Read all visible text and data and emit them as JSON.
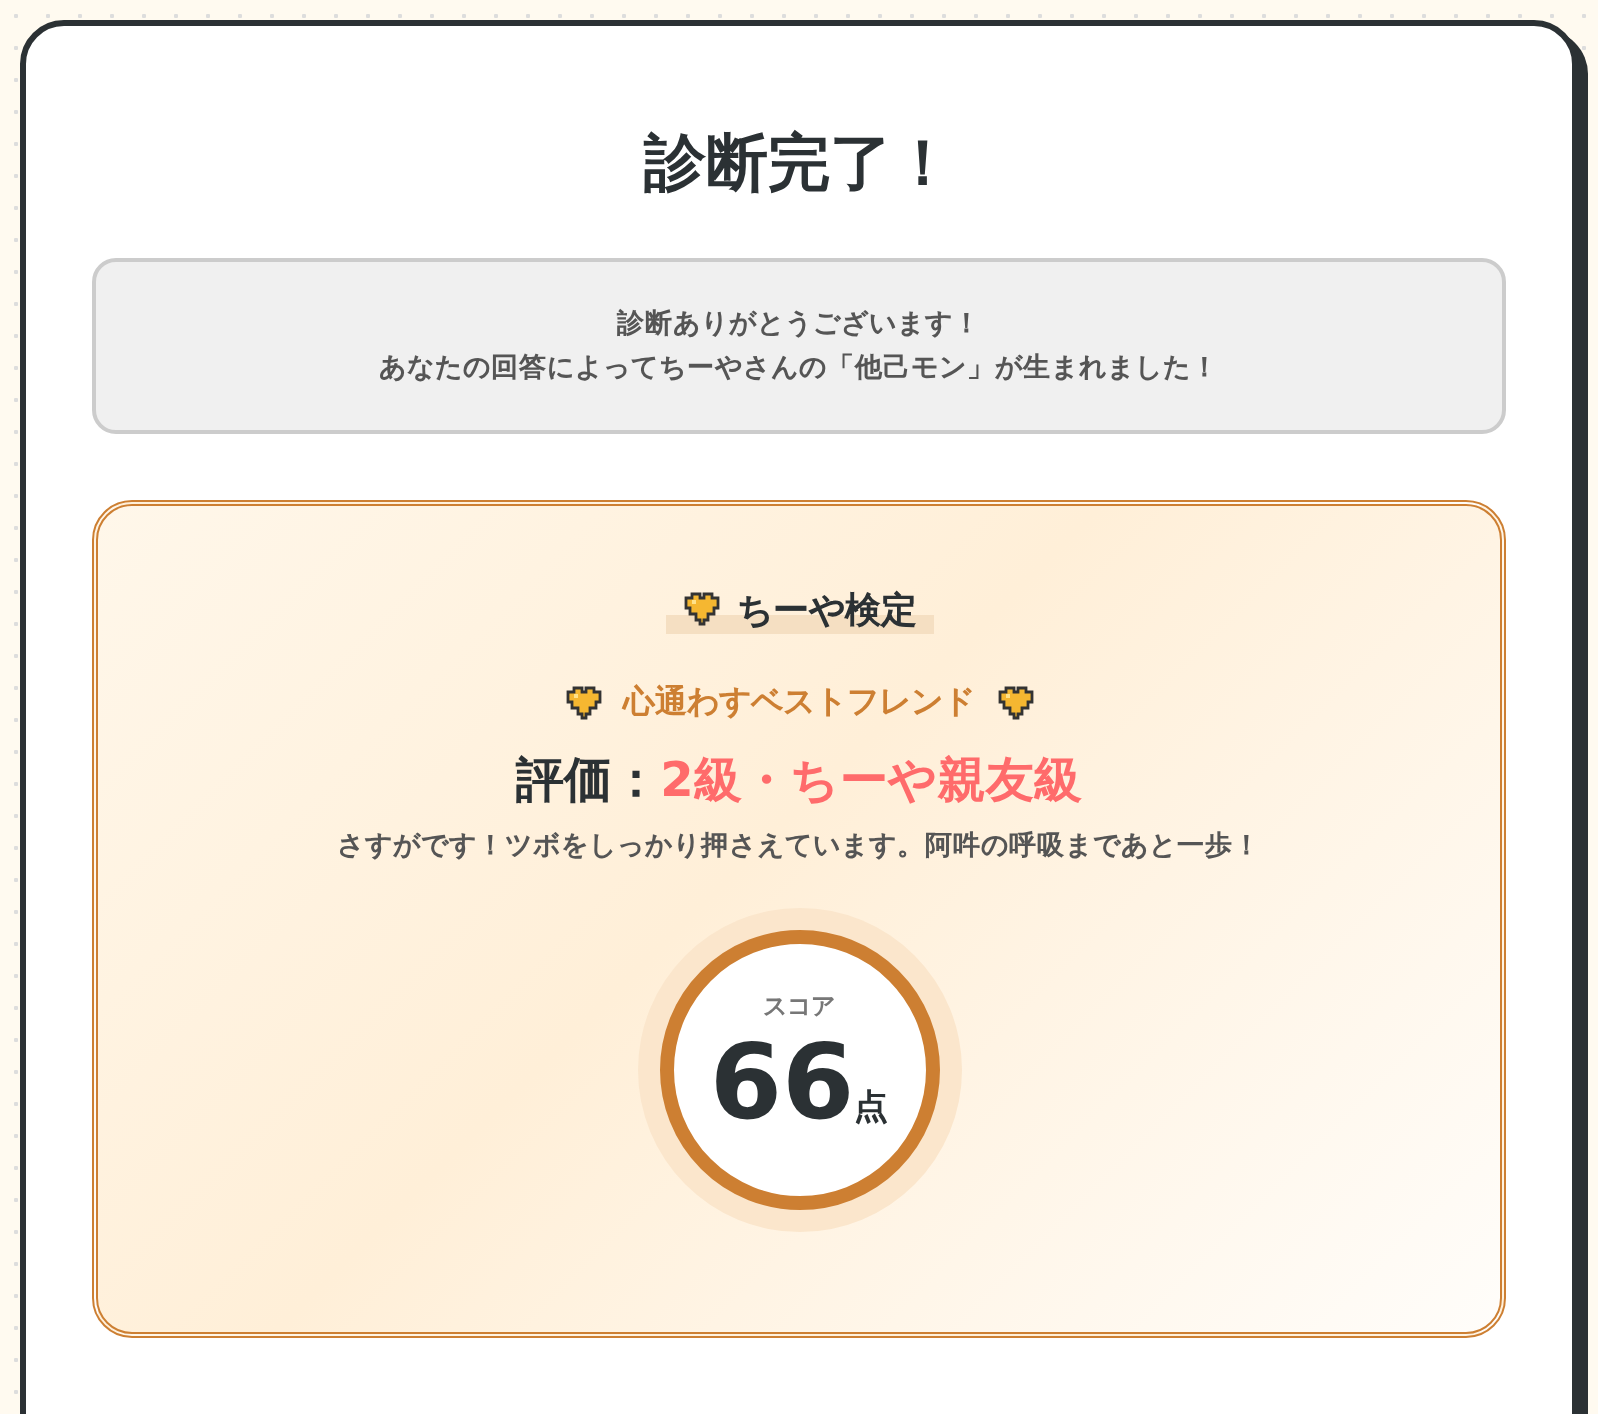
{
  "title": "診断完了！",
  "message": {
    "lines": [
      "診断ありがとうございます！",
      "あなたの回答によってちーやさんの「他己モン」が生まれました！"
    ]
  },
  "result": {
    "heading": "ちーや検定",
    "type_name": "心通わすベストフレンド",
    "rating_label": "評価：",
    "rating_value": "2級・ちーや親友級",
    "comment": "さすがです！ツボをしっかり押さえています。阿吽の呼吸まであと一歩！",
    "score": {
      "label": "スコア",
      "value": "66",
      "unit": "点"
    }
  }
}
